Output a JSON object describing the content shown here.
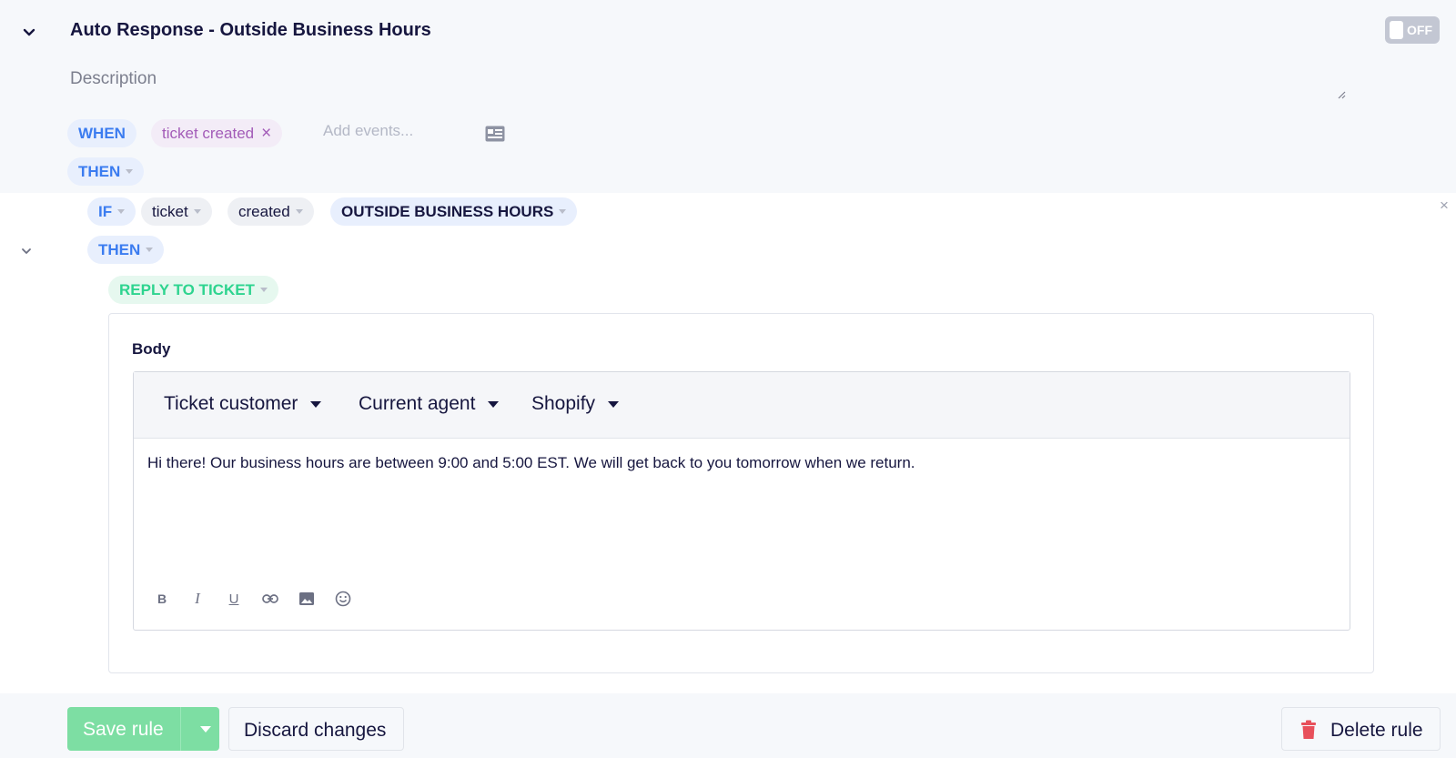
{
  "rule": {
    "title": "Auto Response - Outside Business Hours",
    "toggle_label": "OFF",
    "description_placeholder": "Description"
  },
  "trigger": {
    "when_label": "WHEN",
    "event_tag": "ticket created",
    "event_remove": "×",
    "add_events_placeholder": "Add events...",
    "then_label": "THEN"
  },
  "condition": {
    "if_label": "IF",
    "object": "ticket",
    "field": "created",
    "operator": "OUTSIDE BUSINESS HOURS",
    "then_label": "THEN",
    "close": "×"
  },
  "action": {
    "type": "REPLY TO TICKET",
    "body_label": "Body",
    "variable_menus": [
      "Ticket customer",
      "Current agent",
      "Shopify"
    ],
    "body_text": "Hi there! Our business hours are between 9:00 and 5:00 EST. We will get back to you tomorrow when we return.",
    "format_tools": [
      "bold-icon",
      "italic-icon",
      "underline-icon",
      "link-icon",
      "image-icon",
      "emoji-icon"
    ]
  },
  "footer": {
    "save_label": "Save rule",
    "discard_label": "Discard changes",
    "delete_label": "Delete rule"
  },
  "colors": {
    "accent_blue": "#3b7cf0",
    "save_green": "#7ddea3",
    "action_green": "#2ed48f",
    "tag_purple": "#a35cb8",
    "danger_red": "#e8505b",
    "text_dark": "#16163f"
  }
}
